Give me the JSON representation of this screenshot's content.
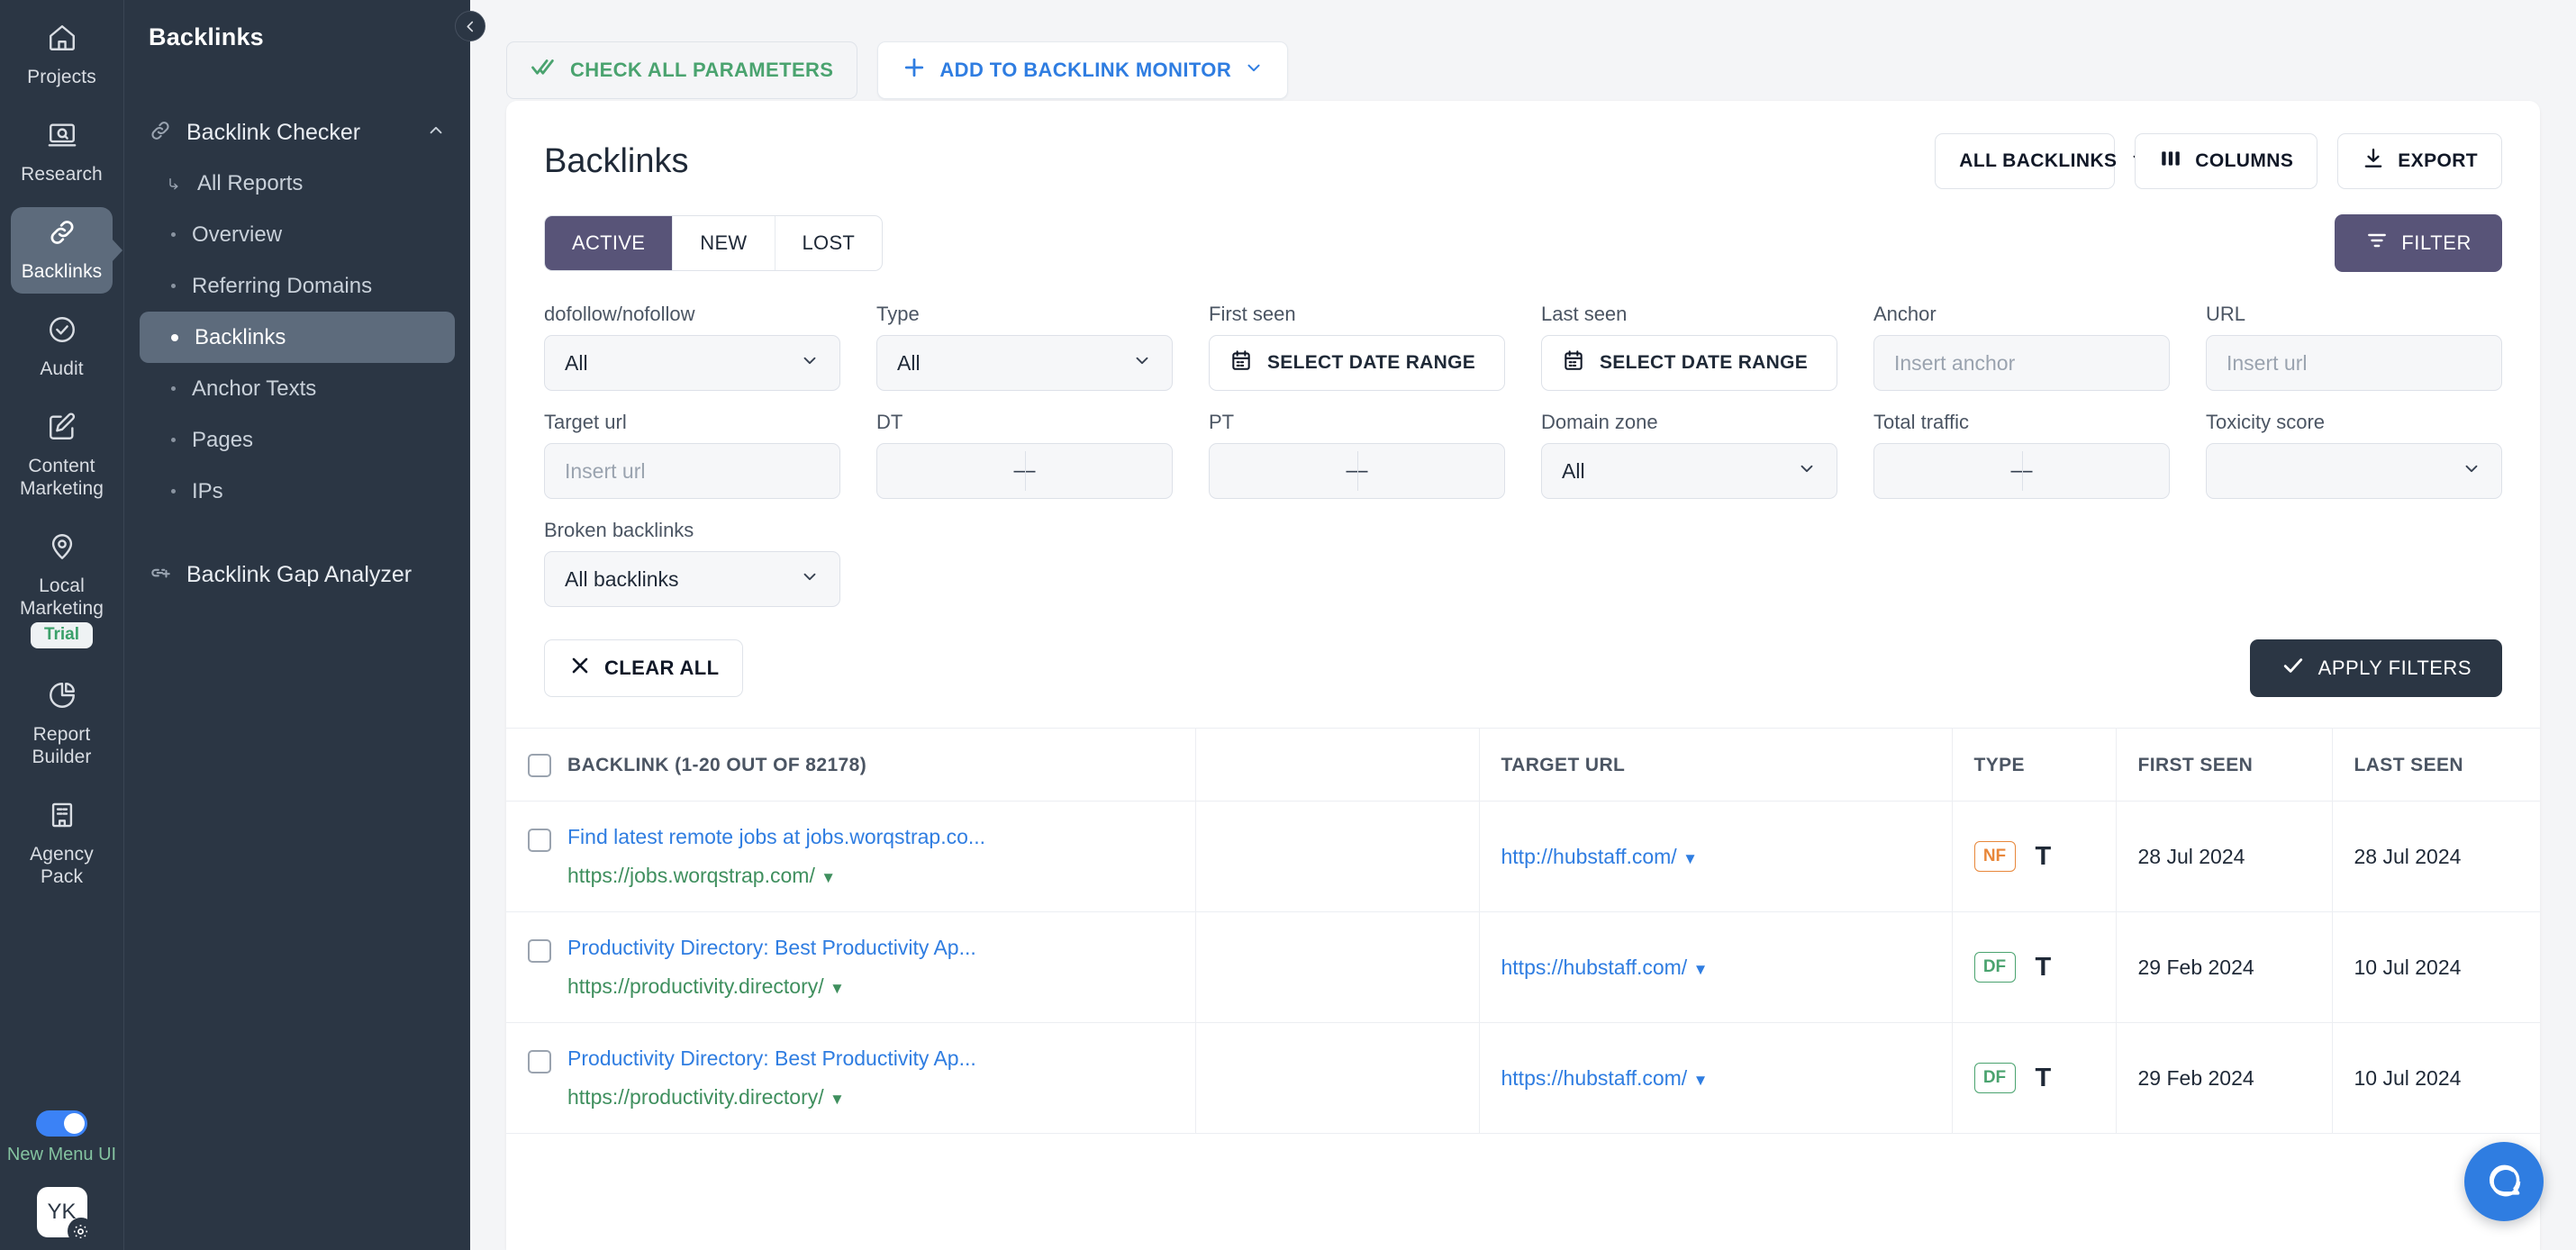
{
  "rail": {
    "items": [
      {
        "label": "Projects",
        "icon": "home-icon",
        "active": false
      },
      {
        "label": "Research",
        "icon": "research-icon",
        "active": false
      },
      {
        "label": "Backlinks",
        "icon": "link-icon",
        "active": true
      },
      {
        "label": "Audit",
        "icon": "check-circle-icon",
        "active": false
      },
      {
        "label": "Content Marketing",
        "icon": "pencil-square-icon",
        "active": false
      },
      {
        "label": "Local Marketing",
        "icon": "map-pin-icon",
        "active": false,
        "badge": "Trial"
      },
      {
        "label": "Report Builder",
        "icon": "pie-chart-icon",
        "active": false
      },
      {
        "label": "Agency Pack",
        "icon": "building-icon",
        "active": false
      }
    ],
    "toggle_label": "New Menu UI",
    "avatar_initials": "YK"
  },
  "subnav": {
    "title": "Backlinks",
    "group": {
      "label": "Backlink Checker",
      "icon": "link-icon"
    },
    "items": [
      {
        "label": "All Reports",
        "active": false,
        "icon": "return-arrow-icon"
      },
      {
        "label": "Overview",
        "active": false
      },
      {
        "label": "Referring Domains",
        "active": false
      },
      {
        "label": "Backlinks",
        "active": true
      },
      {
        "label": "Anchor Texts",
        "active": false
      },
      {
        "label": "Pages",
        "active": false
      },
      {
        "label": "IPs",
        "active": false
      }
    ],
    "gap_analyzer": {
      "label": "Backlink Gap Analyzer",
      "icon": "link-plus-icon"
    }
  },
  "toolbar": {
    "check_all_parameters": "CHECK ALL PARAMETERS",
    "add_to_backlink_monitor": "ADD TO BACKLINK MONITOR"
  },
  "header": {
    "title": "Backlinks",
    "all_backlinks": "ALL BACKLINKS",
    "columns": "COLUMNS",
    "export": "EXPORT"
  },
  "tabs": {
    "items": [
      {
        "label": "ACTIVE",
        "active": true
      },
      {
        "label": "NEW",
        "active": false
      },
      {
        "label": "LOST",
        "active": false
      }
    ],
    "filter_button": "FILTER"
  },
  "filters": {
    "dofollow_label": "dofollow/nofollow",
    "dofollow_value": "All",
    "type_label": "Type",
    "type_value": "All",
    "first_seen_label": "First seen",
    "first_seen_value": "SELECT DATE RANGE",
    "last_seen_label": "Last seen",
    "last_seen_value": "SELECT DATE RANGE",
    "anchor_label": "Anchor",
    "anchor_placeholder": "Insert anchor",
    "url_label": "URL",
    "url_placeholder": "Insert url",
    "target_url_label": "Target url",
    "target_url_placeholder": "Insert url",
    "dt_label": "DT",
    "dt_value": "—",
    "pt_label": "PT",
    "pt_value": "—",
    "domain_zone_label": "Domain zone",
    "domain_zone_value": "All",
    "total_traffic_label": "Total traffic",
    "total_traffic_value": "—",
    "toxicity_label": "Toxicity score",
    "toxicity_value": "",
    "broken_label": "Broken backlinks",
    "broken_value": "All backlinks",
    "clear_all": "CLEAR ALL",
    "apply_filters": "APPLY FILTERS"
  },
  "table": {
    "columns": [
      "BACKLINK (1-20 OUT OF 82178)",
      "",
      "TARGET URL",
      "TYPE",
      "FIRST SEEN",
      "LAST SEEN"
    ],
    "rows": [
      {
        "anchor": "Find latest remote jobs at jobs.worqstrap.co...",
        "source_url": "https://jobs.worqstrap.com/",
        "target_url": "http://hubstaff.com/",
        "type_badge": "NF",
        "type_kind": "nofollow",
        "type_glyph": "T",
        "first_seen": "28 Jul 2024",
        "last_seen": "28 Jul 2024"
      },
      {
        "anchor": "Productivity Directory: Best Productivity Ap...",
        "source_url": "https://productivity.directory/",
        "target_url": "https://hubstaff.com/",
        "type_badge": "DF",
        "type_kind": "dofollow",
        "type_glyph": "T",
        "first_seen": "29 Feb 2024",
        "last_seen": "10 Jul 2024"
      },
      {
        "anchor": "Productivity Directory: Best Productivity Ap...",
        "source_url": "https://productivity.directory/",
        "target_url": "https://hubstaff.com/",
        "type_badge": "DF",
        "type_kind": "dofollow",
        "type_glyph": "T",
        "first_seen": "29 Feb 2024",
        "last_seen": "10 Jul 2024"
      }
    ]
  },
  "colors": {
    "rail_bg": "#2b3644",
    "accent_purple": "#585478",
    "link_blue": "#2f7de1",
    "link_green": "#3f8f5e",
    "nofollow_orange": "#e8873a",
    "dofollow_green": "#4aa36f"
  }
}
